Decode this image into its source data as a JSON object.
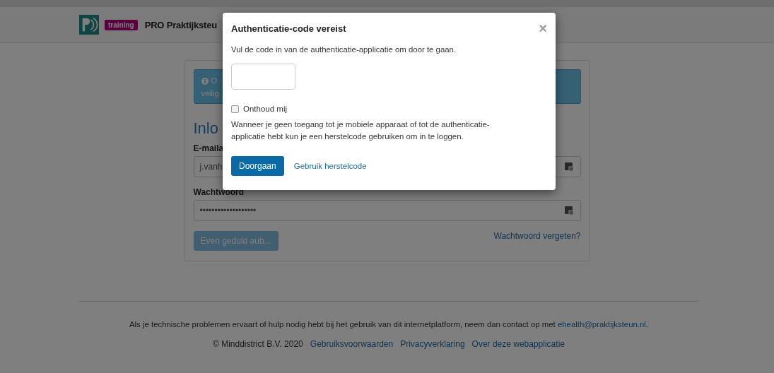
{
  "header": {
    "badge": "training",
    "title": "PRO Praktijksteu"
  },
  "login": {
    "alert": {
      "lines": [
        "O",
        "veilig"
      ]
    },
    "heading": "Inlo",
    "fields": [
      {
        "label": "E-maila",
        "value": "j.vanh"
      },
      {
        "label": "Wachtwoord",
        "value": "•••••••••••••••••••"
      }
    ],
    "submit": {
      "label": "Even geduld aub...",
      "disabled": true
    },
    "forgot": "Wachtwoord vergeten?"
  },
  "footer": {
    "text": "Als je technische problemen ervaart of hulp nodig hebt bij het gebruik van dit internetplatform, neem dan contact op met ",
    "email": "ehealth@praktijksteun.nl",
    "end": ".",
    "copyright": "© Minddistrict B.V. 2020",
    "links": [
      "Gebruiksvoorwaarden",
      "Privacyverklaring",
      "Over deze webapplicatie"
    ]
  },
  "modal": {
    "title": "Authenticatie-code vereist",
    "close": "×",
    "intro": "Vul de code in van de authenticatie-applicatie om door te gaan.",
    "remember": {
      "label": "Onthoud mij",
      "checked": false
    },
    "note": "Wanneer je geen toegang tot je mobiele apparaat of tot de authenticatie-applicatie hebt kun je een herstelcode gebruiken om in te loggen.",
    "primary": "Doorgaan",
    "secondary": "Gebruik herstelcode"
  }
}
